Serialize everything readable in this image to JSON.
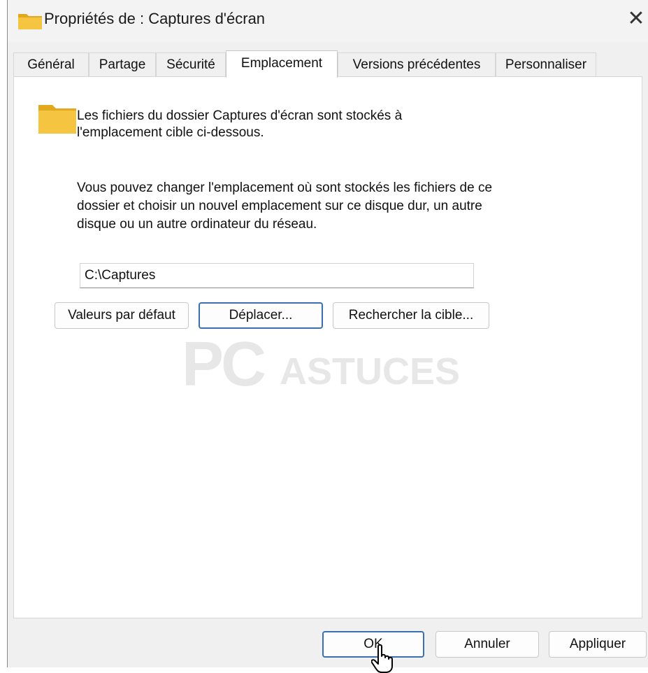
{
  "window": {
    "title": "Propriétés de : Captures d'écran",
    "close_glyph": "✕"
  },
  "tabs": [
    {
      "label": "Général",
      "active": false
    },
    {
      "label": "Partage",
      "active": false
    },
    {
      "label": "Sécurité",
      "active": false
    },
    {
      "label": "Emplacement",
      "active": true
    },
    {
      "label": "Versions précédentes",
      "active": false
    },
    {
      "label": "Personnaliser",
      "active": false
    }
  ],
  "location": {
    "intro": "Les fichiers du dossier Captures d'écran sont stockés à l'emplacement cible ci-dessous.",
    "description": "Vous pouvez changer l'emplacement où sont stockés les fichiers de ce dossier et choisir un nouvel emplacement sur ce disque dur, un autre disque ou un autre ordinateur du réseau.",
    "path_value": "C:\\Captures",
    "restore_label": "Valeurs par défaut",
    "move_label": "Déplacer...",
    "find_target_label": "Rechercher la cible..."
  },
  "footer": {
    "ok_label": "OK",
    "cancel_label": "Annuler",
    "apply_label": "Appliquer"
  },
  "watermark": {
    "mark": "PC",
    "word": "ASTUCES"
  },
  "icons": {
    "title": "folder-icon",
    "panel": "folder-icon",
    "close": "close-icon",
    "cursor": "pointer-cursor-icon"
  },
  "colors": {
    "folder": "#f5c542",
    "folder_dark": "#e2a91f",
    "default_button_border": "#3a6fb0",
    "dialog_bg": "#f0f0f0"
  }
}
